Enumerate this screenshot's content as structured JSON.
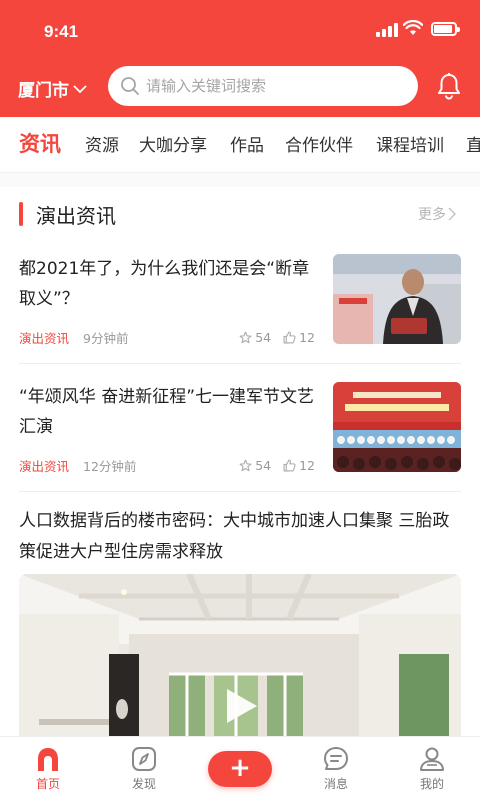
{
  "status_bar": {
    "time": "9:41"
  },
  "header": {
    "city": "厦门市",
    "search_placeholder": "请输入关键词搜索",
    "bell_icon": "bell-icon"
  },
  "tabs": [
    "资讯",
    "资源",
    "大咖分享",
    "作品",
    "合作伙伴",
    "课程培训",
    "直"
  ],
  "section": {
    "title": "演出资讯",
    "more": "更多"
  },
  "news": [
    {
      "title": "都2021年了，为什么我们还是会“断章取义”？",
      "tag": "演出资讯",
      "time": "9分钟前",
      "stars": "54",
      "likes": "12"
    },
    {
      "title": "“年颂风华 奋进新征程”七一建军节文艺汇演",
      "tag": "演出资讯",
      "time": "12分钟前",
      "stars": "54",
      "likes": "12"
    }
  ],
  "feature": {
    "title": "人口数据背后的楼市密码：大中城市加速人口集聚 三胎政策促进大户型住房需求释放"
  },
  "bottom_nav": [
    {
      "label": "首页",
      "icon": "home-icon"
    },
    {
      "label": "发现",
      "icon": "compass-icon"
    },
    {
      "label": "+",
      "icon": "plus-icon"
    },
    {
      "label": "消息",
      "icon": "message-icon"
    },
    {
      "label": "我的",
      "icon": "user-icon"
    }
  ],
  "colors": {
    "accent": "#f4463d",
    "muted": "#999999"
  }
}
